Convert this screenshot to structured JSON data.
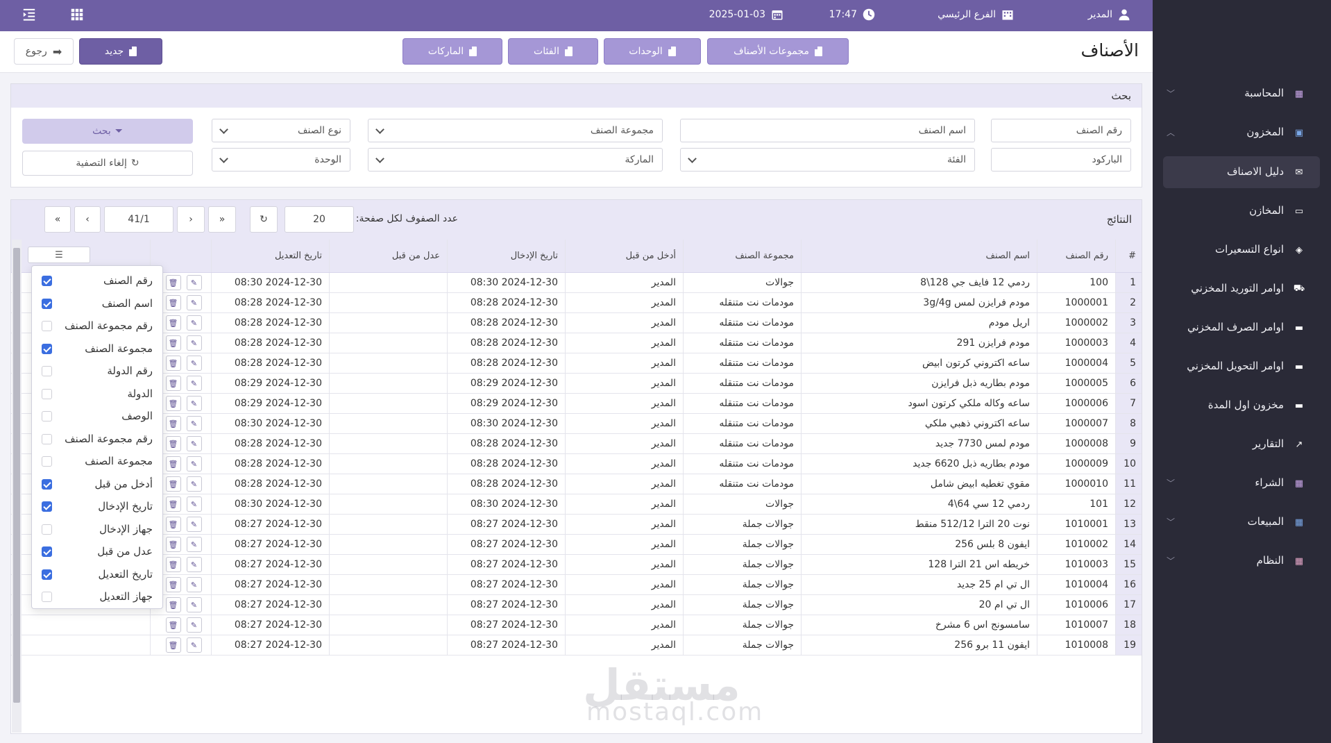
{
  "topbar": {
    "user": "المدير",
    "branch": "الفرع الرئيسي",
    "time": "17:47",
    "date": "2025-01-03"
  },
  "page": {
    "title": "الأصناف"
  },
  "tabs": [
    "مجموعات الأصناف",
    "الوحدات",
    "الفئات",
    "الماركات"
  ],
  "actions": {
    "new": "جديد",
    "back": "رجوع"
  },
  "sidebar": [
    {
      "label": "المحاسبة",
      "icon": "accounting-icon",
      "chevron": "down"
    },
    {
      "label": "المخزون",
      "icon": "inventory-icon",
      "chevron": "up"
    },
    {
      "label": "دليل الاصناف",
      "icon": "items-guide-icon",
      "active": true
    },
    {
      "label": "المخازن",
      "icon": "warehouse-icon"
    },
    {
      "label": "انواع التسعيرات",
      "icon": "tag-icon"
    },
    {
      "label": "اوامر التوريد المخزني",
      "icon": "truck-icon"
    },
    {
      "label": "اوامر الصرف المخزني",
      "icon": "dispatch-icon"
    },
    {
      "label": "اوامر التحويل المخزني",
      "icon": "transfer-icon"
    },
    {
      "label": "مخزون اول المدة",
      "icon": "opening-stock-icon"
    },
    {
      "label": "التقارير",
      "icon": "chart-line-icon"
    },
    {
      "label": "الشراء",
      "icon": "purchase-icon",
      "chevron": "down"
    },
    {
      "label": "المبيعات",
      "icon": "sales-icon",
      "chevron": "down"
    },
    {
      "label": "النظام",
      "icon": "system-icon",
      "chevron": "down"
    }
  ],
  "search": {
    "title": "بحث",
    "item_no": "رقم الصنف",
    "item_name": "اسم الصنف",
    "item_group": "مجموعة الصنف",
    "item_type": "نوع الصنف",
    "barcode": "الباركود",
    "category": "الفئة",
    "brand": "الماركة",
    "unit": "الوحدة",
    "search_btn": "بحث",
    "clear_btn": "إلغاء التصفية"
  },
  "results": {
    "title": "النتائج",
    "rows_per_page_label": "عدد الصفوف لكل صفحة:",
    "rows_per_page": "20",
    "page": "41/1"
  },
  "columns": {
    "num": "#",
    "item_no": "رقم الصنف",
    "item_name": "اسم الصنف",
    "item_group": "مجموعة الصنف",
    "entered_by": "أدخل من قبل",
    "entry_date": "تاريخ الإدخال",
    "modified_by": "عدل من قبل",
    "modified_date": "تاريخ التعديل"
  },
  "rows": [
    {
      "n": "1",
      "no": "100",
      "name": "ردمي 12 فايف جي 128\\8",
      "group": "جوالات",
      "by": "المدير",
      "date": "2024-12-30 08:30",
      "mdate": "2024-12-30 08:30"
    },
    {
      "n": "2",
      "no": "1000001",
      "name": "مودم فرايزن لمس 3g/4g",
      "group": "مودمات نت متنقله",
      "by": "المدير",
      "date": "2024-12-30 08:28",
      "mdate": "2024-12-30 08:28"
    },
    {
      "n": "3",
      "no": "1000002",
      "name": "اريل مودم",
      "group": "مودمات نت متنقله",
      "by": "المدير",
      "date": "2024-12-30 08:28",
      "mdate": "2024-12-30 08:28"
    },
    {
      "n": "4",
      "no": "1000003",
      "name": "مودم فرايزن 291",
      "group": "مودمات نت متنقله",
      "by": "المدير",
      "date": "2024-12-30 08:28",
      "mdate": "2024-12-30 08:28"
    },
    {
      "n": "5",
      "no": "1000004",
      "name": "ساعه اكتروني كرتون ابيض",
      "group": "مودمات نت متنقله",
      "by": "المدير",
      "date": "2024-12-30 08:28",
      "mdate": "2024-12-30 08:28"
    },
    {
      "n": "6",
      "no": "1000005",
      "name": "مودم بطاريه ذبل فرايزن",
      "group": "مودمات نت متنقله",
      "by": "المدير",
      "date": "2024-12-30 08:29",
      "mdate": "2024-12-30 08:29"
    },
    {
      "n": "7",
      "no": "1000006",
      "name": "ساعه وكاله ملكي كرتون اسود",
      "group": "مودمات نت متنقله",
      "by": "المدير",
      "date": "2024-12-30 08:29",
      "mdate": "2024-12-30 08:29"
    },
    {
      "n": "8",
      "no": "1000007",
      "name": "ساعه اكتروني ذهبي ملكي",
      "group": "مودمات نت متنقله",
      "by": "المدير",
      "date": "2024-12-30 08:30",
      "mdate": "2024-12-30 08:30"
    },
    {
      "n": "9",
      "no": "1000008",
      "name": "مودم لمس 7730 جديد",
      "group": "مودمات نت متنقله",
      "by": "المدير",
      "date": "2024-12-30 08:28",
      "mdate": "2024-12-30 08:28"
    },
    {
      "n": "10",
      "no": "1000009",
      "name": "مودم بطاريه ذبل 6620 جديد",
      "group": "مودمات نت متنقله",
      "by": "المدير",
      "date": "2024-12-30 08:28",
      "mdate": "2024-12-30 08:28"
    },
    {
      "n": "11",
      "no": "1000010",
      "name": "مقوي تغطيه ابيض شامل",
      "group": "مودمات نت متنقله",
      "by": "المدير",
      "date": "2024-12-30 08:28",
      "mdate": "2024-12-30 08:28"
    },
    {
      "n": "12",
      "no": "101",
      "name": "ردمي 12 سي 64\\4",
      "group": "جوالات",
      "by": "المدير",
      "date": "2024-12-30 08:30",
      "mdate": "2024-12-30 08:30"
    },
    {
      "n": "13",
      "no": "1010001",
      "name": "نوت 20 الترا 512/12 منقط",
      "group": "جوالات جملة",
      "by": "المدير",
      "date": "2024-12-30 08:27",
      "mdate": "2024-12-30 08:27"
    },
    {
      "n": "14",
      "no": "1010002",
      "name": "ايفون 8 بلس 256",
      "group": "جوالات جملة",
      "by": "المدير",
      "date": "2024-12-30 08:27",
      "mdate": "2024-12-30 08:27"
    },
    {
      "n": "15",
      "no": "1010003",
      "name": "خريطه اس 21 الترا 128",
      "group": "جوالات جملة",
      "by": "المدير",
      "date": "2024-12-30 08:27",
      "mdate": "2024-12-30 08:27"
    },
    {
      "n": "16",
      "no": "1010004",
      "name": "ال تي ام 25 جديد",
      "group": "جوالات جملة",
      "by": "المدير",
      "date": "2024-12-30 08:27",
      "mdate": "2024-12-30 08:27"
    },
    {
      "n": "17",
      "no": "1010006",
      "name": "ال تي ام 20",
      "group": "جوالات جملة",
      "by": "المدير",
      "date": "2024-12-30 08:27",
      "mdate": "2024-12-30 08:27"
    },
    {
      "n": "18",
      "no": "1010007",
      "name": "سامسونج اس 6 مشرخ",
      "group": "جوالات جملة",
      "by": "المدير",
      "date": "2024-12-30 08:27",
      "mdate": "2024-12-30 08:27"
    },
    {
      "n": "19",
      "no": "1010008",
      "name": "ايفون 11 برو 256",
      "group": "جوالات جملة",
      "by": "المدير",
      "date": "2024-12-30 08:27",
      "mdate": "2024-12-30 08:27"
    }
  ],
  "column_chooser": [
    {
      "label": "رقم الصنف",
      "checked": true
    },
    {
      "label": "اسم الصنف",
      "checked": true
    },
    {
      "label": "رقم مجموعة الصنف",
      "checked": false
    },
    {
      "label": "مجموعة الصنف",
      "checked": true
    },
    {
      "label": "رقم الدولة",
      "checked": false
    },
    {
      "label": "الدولة",
      "checked": false
    },
    {
      "label": "الوصف",
      "checked": false
    },
    {
      "label": "رقم مجموعة الصنف",
      "checked": false
    },
    {
      "label": "مجموعة الصنف",
      "checked": false
    },
    {
      "label": "أدخل من قبل",
      "checked": true
    },
    {
      "label": "تاريخ الإدخال",
      "checked": true
    },
    {
      "label": "جهاز الإدخال",
      "checked": false
    },
    {
      "label": "عدل من قبل",
      "checked": true
    },
    {
      "label": "تاريخ التعديل",
      "checked": true
    },
    {
      "label": "جهاز التعديل",
      "checked": false
    }
  ],
  "watermark": {
    "ar": "مستقل",
    "en": "mostaql.com"
  },
  "colors": {
    "primary": "#6e5fa4",
    "light": "#a597d6",
    "sidebar": "#2a2a37",
    "panel_head": "#e9e7f6"
  }
}
